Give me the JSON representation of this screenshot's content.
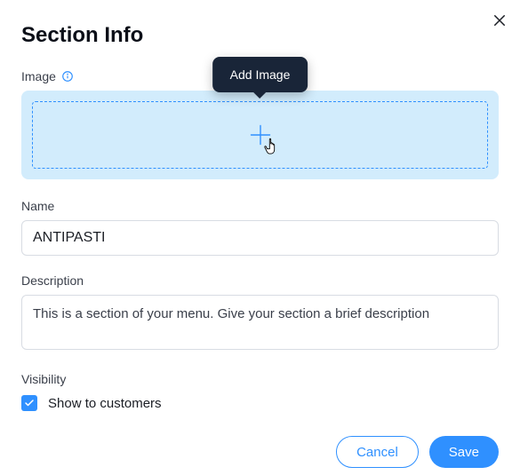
{
  "title": "Section Info",
  "tooltip_add_image": "Add Image",
  "fields": {
    "image": {
      "label": "Image"
    },
    "name": {
      "label": "Name",
      "value": "ANTIPASTI"
    },
    "description": {
      "label": "Description",
      "placeholder": "This is a section of your menu. Give your section a brief description"
    },
    "visibility": {
      "label": "Visibility",
      "checkbox_label": "Show to customers",
      "checked": true
    }
  },
  "buttons": {
    "cancel": "Cancel",
    "save": "Save"
  }
}
